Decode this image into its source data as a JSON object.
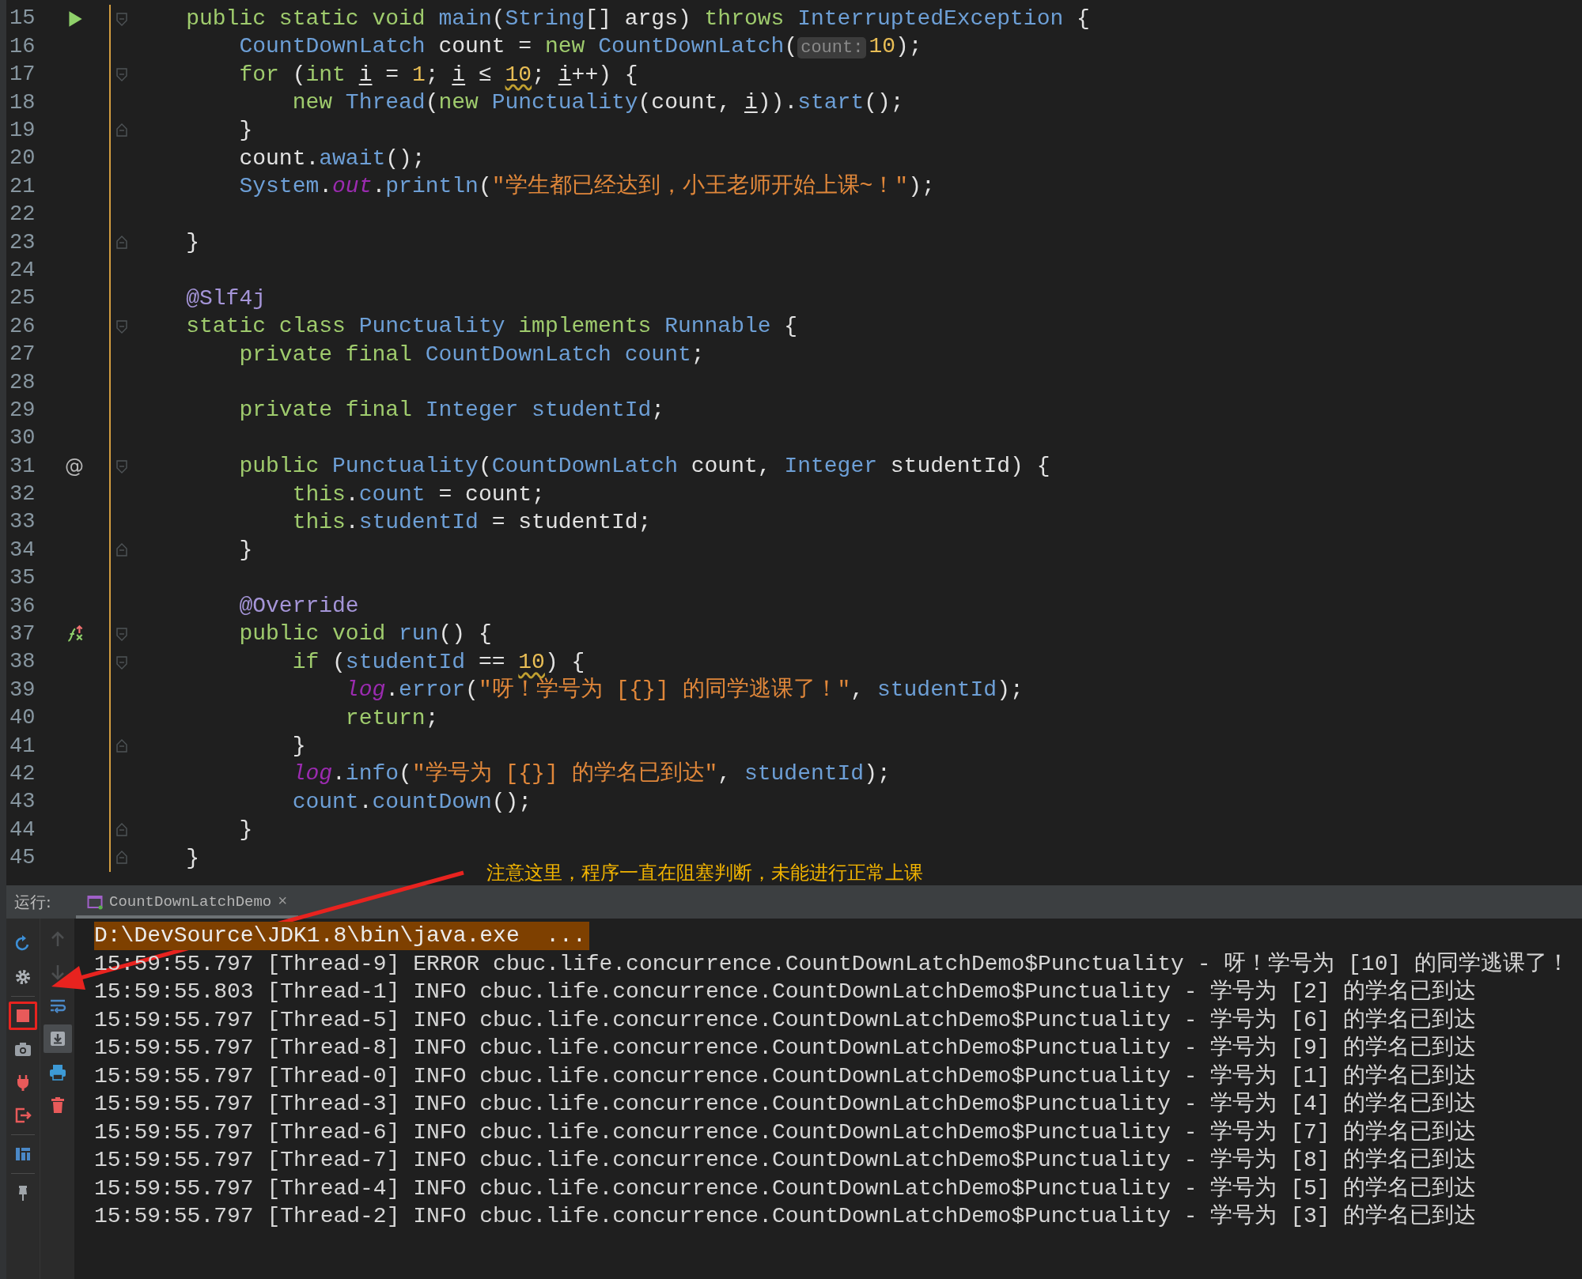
{
  "editor": {
    "lines": [
      {
        "number": "15",
        "gutter": {
          "kind": "run"
        },
        "fold": {
          "kind": "start"
        },
        "tokens": [
          {
            "text": "    public static void ",
            "kind": "kw"
          },
          {
            "text": "main",
            "kind": "type"
          },
          {
            "text": "(",
            "kind": "plain"
          },
          {
            "text": "String",
            "kind": "type"
          },
          {
            "text": "[] args) ",
            "kind": "plain"
          },
          {
            "text": "throws ",
            "kind": "kw"
          },
          {
            "text": "InterruptedException",
            "kind": "type"
          },
          {
            "text": " {",
            "kind": "plain"
          }
        ]
      },
      {
        "number": "16",
        "tokens": [
          {
            "text": "        CountDownLatch",
            "kind": "type"
          },
          {
            "text": " count = ",
            "kind": "plain"
          },
          {
            "text": "new ",
            "kind": "kw"
          },
          {
            "text": "CountDownLatch",
            "kind": "type"
          },
          {
            "text": "(",
            "kind": "plain"
          },
          {
            "text": "count:",
            "kind": "hint"
          },
          {
            "text": "10",
            "kind": "num"
          },
          {
            "text": ");",
            "kind": "plain"
          }
        ]
      },
      {
        "number": "17",
        "fold": {
          "kind": "start"
        },
        "tokens": [
          {
            "text": "        for ",
            "kind": "kw"
          },
          {
            "text": "(",
            "kind": "plain"
          },
          {
            "text": "int ",
            "kind": "kw"
          },
          {
            "text": "i",
            "kind": "var"
          },
          {
            "text": " = ",
            "kind": "plain"
          },
          {
            "text": "1",
            "kind": "num"
          },
          {
            "text": "; ",
            "kind": "plain"
          },
          {
            "text": "i",
            "kind": "var"
          },
          {
            "text": " ≤ ",
            "kind": "plain"
          },
          {
            "text": "10",
            "kind": "num_warning"
          },
          {
            "text": "; ",
            "kind": "plain"
          },
          {
            "text": "i",
            "kind": "var"
          },
          {
            "text": "++) {",
            "kind": "plain"
          }
        ]
      },
      {
        "number": "18",
        "tokens": [
          {
            "text": "            new ",
            "kind": "kw"
          },
          {
            "text": "Thread",
            "kind": "type"
          },
          {
            "text": "(",
            "kind": "plain"
          },
          {
            "text": "new ",
            "kind": "kw"
          },
          {
            "text": "Punctuality",
            "kind": "type"
          },
          {
            "text": "(count, ",
            "kind": "plain"
          },
          {
            "text": "i",
            "kind": "var"
          },
          {
            "text": ")).",
            "kind": "plain"
          },
          {
            "text": "start",
            "kind": "type"
          },
          {
            "text": "();",
            "kind": "plain"
          }
        ]
      },
      {
        "number": "19",
        "fold": {
          "kind": "end"
        },
        "tokens": [
          {
            "text": "        }",
            "kind": "plain"
          }
        ]
      },
      {
        "number": "20",
        "tokens": [
          {
            "text": "        count.",
            "kind": "plain"
          },
          {
            "text": "await",
            "kind": "type"
          },
          {
            "text": "();",
            "kind": "plain"
          }
        ]
      },
      {
        "number": "21",
        "tokens": [
          {
            "text": "        System",
            "kind": "type"
          },
          {
            "text": ".",
            "kind": "plain"
          },
          {
            "text": "out",
            "kind": "static"
          },
          {
            "text": ".",
            "kind": "plain"
          },
          {
            "text": "println",
            "kind": "type"
          },
          {
            "text": "(",
            "kind": "plain"
          },
          {
            "text": "\"学生都已经达到，小王老师开始上课~！\"",
            "kind": "str"
          },
          {
            "text": ");",
            "kind": "plain"
          }
        ]
      },
      {
        "number": "22"
      },
      {
        "number": "23",
        "fold": {
          "kind": "end"
        },
        "tokens": [
          {
            "text": "    }",
            "kind": "plain"
          }
        ]
      },
      {
        "number": "24"
      },
      {
        "number": "25",
        "tokens": [
          {
            "text": "    @Slf4j",
            "kind": "ann"
          }
        ]
      },
      {
        "number": "26",
        "fold": {
          "kind": "start"
        },
        "tokens": [
          {
            "text": "    static class ",
            "kind": "kw"
          },
          {
            "text": "Punctuality",
            "kind": "type"
          },
          {
            "text": " implements ",
            "kind": "kw"
          },
          {
            "text": "Runnable",
            "kind": "type"
          },
          {
            "text": " {",
            "kind": "plain"
          }
        ]
      },
      {
        "number": "27",
        "tokens": [
          {
            "text": "        private final ",
            "kind": "kw"
          },
          {
            "text": "CountDownLatch",
            "kind": "type"
          },
          {
            "text": " count",
            "kind": "field"
          },
          {
            "text": ";",
            "kind": "plain"
          }
        ]
      },
      {
        "number": "28"
      },
      {
        "number": "29",
        "tokens": [
          {
            "text": "        private final ",
            "kind": "kw"
          },
          {
            "text": "Integer",
            "kind": "type"
          },
          {
            "text": " studentId",
            "kind": "field"
          },
          {
            "text": ";",
            "kind": "plain"
          }
        ]
      },
      {
        "number": "30"
      },
      {
        "number": "31",
        "gutter": {
          "kind": "text",
          "text": "@"
        },
        "fold": {
          "kind": "start"
        },
        "tokens": [
          {
            "text": "        public ",
            "kind": "kw"
          },
          {
            "text": "Punctuality",
            "kind": "type"
          },
          {
            "text": "(",
            "kind": "plain"
          },
          {
            "text": "CountDownLatch",
            "kind": "type"
          },
          {
            "text": " count, ",
            "kind": "plain"
          },
          {
            "text": "Integer",
            "kind": "type"
          },
          {
            "text": " studentId) {",
            "kind": "plain"
          }
        ]
      },
      {
        "number": "32",
        "tokens": [
          {
            "text": "            this",
            "kind": "kw"
          },
          {
            "text": ".",
            "kind": "plain"
          },
          {
            "text": "count",
            "kind": "field"
          },
          {
            "text": " = count;",
            "kind": "plain"
          }
        ]
      },
      {
        "number": "33",
        "tokens": [
          {
            "text": "            this",
            "kind": "kw"
          },
          {
            "text": ".",
            "kind": "plain"
          },
          {
            "text": "studentId",
            "kind": "field"
          },
          {
            "text": " = studentId;",
            "kind": "plain"
          }
        ]
      },
      {
        "number": "34",
        "fold": {
          "kind": "end"
        },
        "tokens": [
          {
            "text": "        }",
            "kind": "plain"
          }
        ]
      },
      {
        "number": "35"
      },
      {
        "number": "36",
        "tokens": [
          {
            "text": "        @Override",
            "kind": "ann"
          }
        ]
      },
      {
        "number": "37",
        "gutter": {
          "kind": "override"
        },
        "fold": {
          "kind": "start"
        },
        "tokens": [
          {
            "text": "        public void ",
            "kind": "kw"
          },
          {
            "text": "run",
            "kind": "type"
          },
          {
            "text": "() {",
            "kind": "plain"
          }
        ]
      },
      {
        "number": "38",
        "fold": {
          "kind": "start"
        },
        "tokens": [
          {
            "text": "            if ",
            "kind": "kw"
          },
          {
            "text": "(",
            "kind": "plain"
          },
          {
            "text": "studentId",
            "kind": "field"
          },
          {
            "text": " == ",
            "kind": "plain"
          },
          {
            "text": "10",
            "kind": "num_warning"
          },
          {
            "text": ") {",
            "kind": "plain"
          }
        ]
      },
      {
        "number": "39",
        "tokens": [
          {
            "text": "                log",
            "kind": "static"
          },
          {
            "text": ".",
            "kind": "plain"
          },
          {
            "text": "error",
            "kind": "type"
          },
          {
            "text": "(",
            "kind": "plain"
          },
          {
            "text": "\"呀！学号为 [{}] 的同学逃课了！\"",
            "kind": "str"
          },
          {
            "text": ", ",
            "kind": "plain"
          },
          {
            "text": "studentId",
            "kind": "field"
          },
          {
            "text": ");",
            "kind": "plain"
          }
        ]
      },
      {
        "number": "40",
        "tokens": [
          {
            "text": "                return",
            "kind": "kw"
          },
          {
            "text": ";",
            "kind": "plain"
          }
        ]
      },
      {
        "number": "41",
        "fold": {
          "kind": "end"
        },
        "tokens": [
          {
            "text": "            }",
            "kind": "plain"
          }
        ]
      },
      {
        "number": "42",
        "tokens": [
          {
            "text": "            log",
            "kind": "static"
          },
          {
            "text": ".",
            "kind": "plain"
          },
          {
            "text": "info",
            "kind": "type"
          },
          {
            "text": "(",
            "kind": "plain"
          },
          {
            "text": "\"学号为 [{}] 的学名已到达\"",
            "kind": "str"
          },
          {
            "text": ", ",
            "kind": "plain"
          },
          {
            "text": "studentId",
            "kind": "field"
          },
          {
            "text": ");",
            "kind": "plain"
          }
        ]
      },
      {
        "number": "43",
        "tokens": [
          {
            "text": "            count",
            "kind": "field"
          },
          {
            "text": ".",
            "kind": "plain"
          },
          {
            "text": "countDown",
            "kind": "type"
          },
          {
            "text": "();",
            "kind": "plain"
          }
        ]
      },
      {
        "number": "44",
        "fold": {
          "kind": "end"
        },
        "tokens": [
          {
            "text": "        }",
            "kind": "plain"
          }
        ]
      },
      {
        "number": "45",
        "fold": {
          "kind": "end"
        },
        "tokens": [
          {
            "text": "    }",
            "kind": "plain"
          }
        ]
      }
    ]
  },
  "annotation": {
    "text": "注意这里，程序一直在阻塞判断，未能进行正常上课"
  },
  "run_panel": {
    "label": "运行:",
    "tabs": [
      {
        "title": "CountDownLatchDemo",
        "close": "×",
        "selected": true
      }
    ],
    "toolbar_primary": {
      "groups": [
        [
          {
            "kind": "rerun",
            "highlighted": false
          },
          {
            "kind": "settings",
            "highlighted": false
          }
        ],
        [
          {
            "kind": "stop",
            "highlighted": true
          },
          {
            "kind": "camera",
            "highlighted": false
          },
          {
            "kind": "plug",
            "highlighted": false
          },
          {
            "kind": "exit",
            "highlighted": false
          }
        ],
        [
          {
            "kind": "layout",
            "highlighted": false
          }
        ],
        [
          {
            "kind": "pin",
            "highlighted": false
          }
        ]
      ]
    },
    "toolbar_secondary": [
      {
        "kind": "up",
        "disabled": true,
        "toggled": false
      },
      {
        "kind": "down",
        "disabled": true,
        "toggled": false
      },
      {
        "kind": "wrap",
        "disabled": false,
        "toggled": false
      },
      {
        "kind": "scroll-end",
        "disabled": false,
        "toggled": true
      },
      {
        "kind": "print",
        "disabled": false,
        "toggled": false
      },
      {
        "kind": "trash",
        "disabled": false,
        "toggled": false
      }
    ],
    "console": [
      {
        "kind": "command",
        "text": "D:\\DevSource\\JDK1.8\\bin\\java.exe  ..."
      },
      {
        "kind": "log",
        "text": "15:59:55.797 [Thread-9] ERROR cbuc.life.concurrence.CountDownLatchDemo$Punctuality - 呀！学号为 [10] 的同学逃课了！"
      },
      {
        "kind": "log",
        "text": "15:59:55.803 [Thread-1] INFO cbuc.life.concurrence.CountDownLatchDemo$Punctuality - 学号为 [2] 的学名已到达"
      },
      {
        "kind": "log",
        "text": "15:59:55.797 [Thread-5] INFO cbuc.life.concurrence.CountDownLatchDemo$Punctuality - 学号为 [6] 的学名已到达"
      },
      {
        "kind": "log",
        "text": "15:59:55.797 [Thread-8] INFO cbuc.life.concurrence.CountDownLatchDemo$Punctuality - 学号为 [9] 的学名已到达"
      },
      {
        "kind": "log",
        "text": "15:59:55.797 [Thread-0] INFO cbuc.life.concurrence.CountDownLatchDemo$Punctuality - 学号为 [1] 的学名已到达"
      },
      {
        "kind": "log",
        "text": "15:59:55.797 [Thread-3] INFO cbuc.life.concurrence.CountDownLatchDemo$Punctuality - 学号为 [4] 的学名已到达"
      },
      {
        "kind": "log",
        "text": "15:59:55.797 [Thread-6] INFO cbuc.life.concurrence.CountDownLatchDemo$Punctuality - 学号为 [7] 的学名已到达"
      },
      {
        "kind": "log",
        "text": "15:59:55.797 [Thread-7] INFO cbuc.life.concurrence.CountDownLatchDemo$Punctuality - 学号为 [8] 的学名已到达"
      },
      {
        "kind": "log",
        "text": "15:59:55.797 [Thread-4] INFO cbuc.life.concurrence.CountDownLatchDemo$Punctuality - 学号为 [5] 的学名已到达"
      },
      {
        "kind": "log",
        "text": "15:59:55.797 [Thread-2] INFO cbuc.life.concurrence.CountDownLatchDemo$Punctuality - 学号为 [3] 的学名已到达"
      }
    ]
  }
}
